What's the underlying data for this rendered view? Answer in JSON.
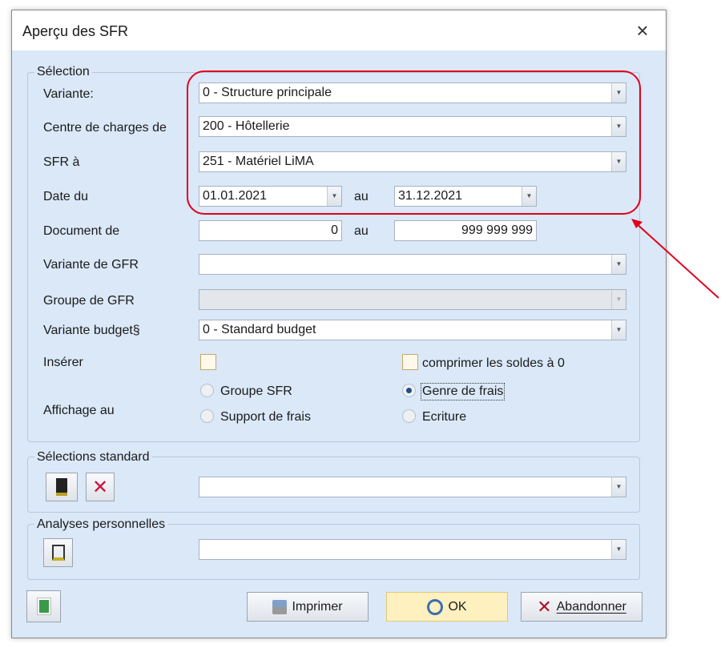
{
  "window": {
    "title": "Aperçu des SFR",
    "close_icon": "×"
  },
  "selection": {
    "legend": "Sélection",
    "variante": {
      "label": "Variante:",
      "value": "0 - Structure principale"
    },
    "centre": {
      "label": "Centre de charges de",
      "value": "200 - Hôtellerie"
    },
    "sfr": {
      "label": "SFR à",
      "value": "251 - Matériel LiMA"
    },
    "date": {
      "label": "Date du",
      "from": "01.01.2021",
      "to_label": "au",
      "to": "31.12.2021"
    },
    "document": {
      "label": "Document de",
      "from": "0",
      "to_label": "au",
      "to": "999 999 999"
    },
    "variante_gfr": {
      "label": "Variante de GFR",
      "value": ""
    },
    "groupe_gfr": {
      "label": "Groupe de GFR",
      "value": ""
    },
    "variante_budget": {
      "label": "Variante budget§",
      "value": "0 - Standard budget"
    },
    "inserer": {
      "label": "Insérer",
      "checked": false
    },
    "comprimer": {
      "label": "comprimer les soldes à 0",
      "checked": false
    },
    "affichage": {
      "label": "Affichage au",
      "options": [
        {
          "label": "Groupe SFR",
          "checked": false
        },
        {
          "label": "Genre de frais",
          "checked": true
        },
        {
          "label": "Support de frais",
          "checked": false
        },
        {
          "label": "Ecriture",
          "checked": false
        }
      ]
    }
  },
  "standard": {
    "legend": "Sélections standard",
    "value": ""
  },
  "analyses": {
    "legend": "Analyses personnelles",
    "value": ""
  },
  "buttons": {
    "print": "Imprimer",
    "ok": "OK",
    "cancel": "Abandonner"
  },
  "colors": {
    "highlight": "#e3001b",
    "ok_bg": "#fff0c0"
  }
}
